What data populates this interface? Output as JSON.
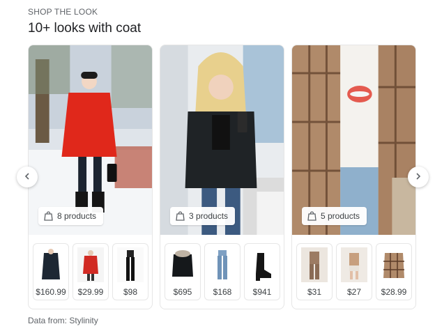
{
  "header": {
    "eyebrow": "SHOP THE LOOK",
    "title": "10+ looks with coat"
  },
  "looks": [
    {
      "count_label": "8 products",
      "products": [
        {
          "price": "$160.99",
          "icon": "navy-coat-icon"
        },
        {
          "price": "$29.99",
          "icon": "red-sweater-icon"
        },
        {
          "price": "$98",
          "icon": "black-leggings-icon"
        }
      ]
    },
    {
      "count_label": "3 products",
      "products": [
        {
          "price": "$695",
          "icon": "puffer-jacket-icon"
        },
        {
          "price": "$168",
          "icon": "jeans-icon"
        },
        {
          "price": "$941",
          "icon": "ankle-boot-icon"
        }
      ]
    },
    {
      "count_label": "5 products",
      "products": [
        {
          "price": "$31",
          "icon": "lounge-set-icon"
        },
        {
          "price": "$27",
          "icon": "shorts-outfit-icon"
        },
        {
          "price": "$28.99",
          "icon": "plaid-shacket-icon"
        }
      ]
    }
  ],
  "navigation": {
    "prev_icon": "chevron-left-icon",
    "next_icon": "chevron-right-icon"
  },
  "footer": {
    "source_text": "Data from: Stylinity"
  },
  "colors": {
    "red_coat": "#e0281b",
    "puffer": "#1f2326",
    "plaid": "#b08a6a"
  }
}
